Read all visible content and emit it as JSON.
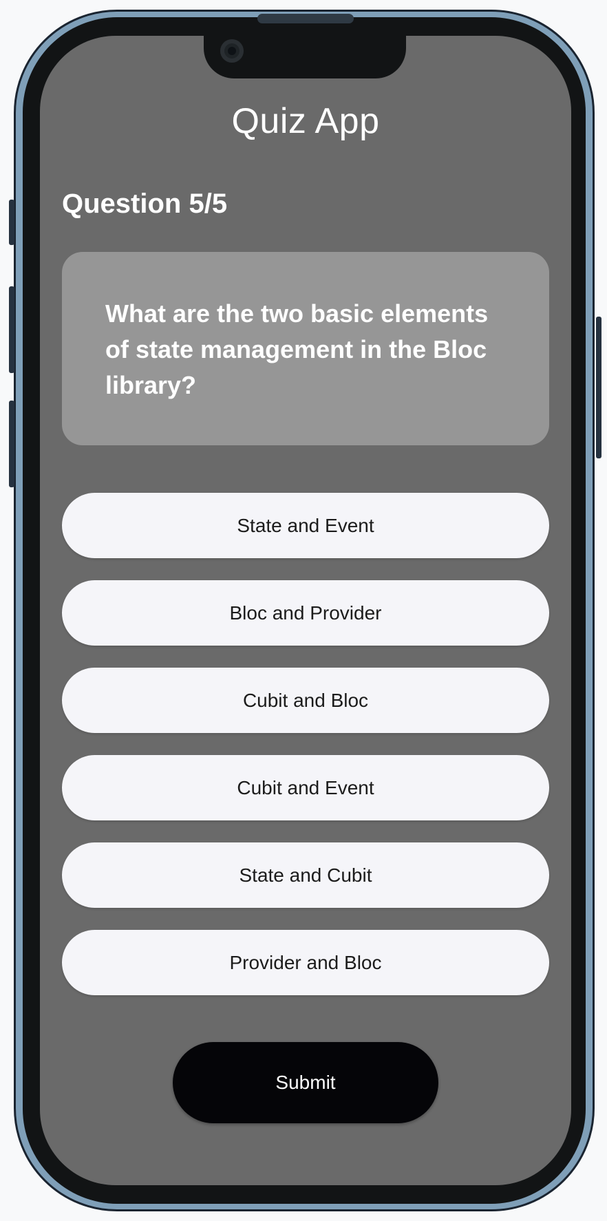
{
  "app": {
    "title": "Quiz App"
  },
  "quiz": {
    "counter": "Question 5/5",
    "question": "What are the two basic elements of state management in the Bloc library?",
    "answers": [
      {
        "label": "State and Event"
      },
      {
        "label": "Bloc and Provider"
      },
      {
        "label": "Cubit and Bloc"
      },
      {
        "label": "Cubit and Event"
      },
      {
        "label": "State and Cubit"
      },
      {
        "label": "Provider and Bloc"
      }
    ],
    "submit_label": "Submit"
  },
  "colors": {
    "screen_background": "#6a6a6a",
    "question_card": "#969696",
    "answer_button": "#f5f5f9",
    "submit_button": "#050508",
    "frame": "#7f9fb8"
  }
}
